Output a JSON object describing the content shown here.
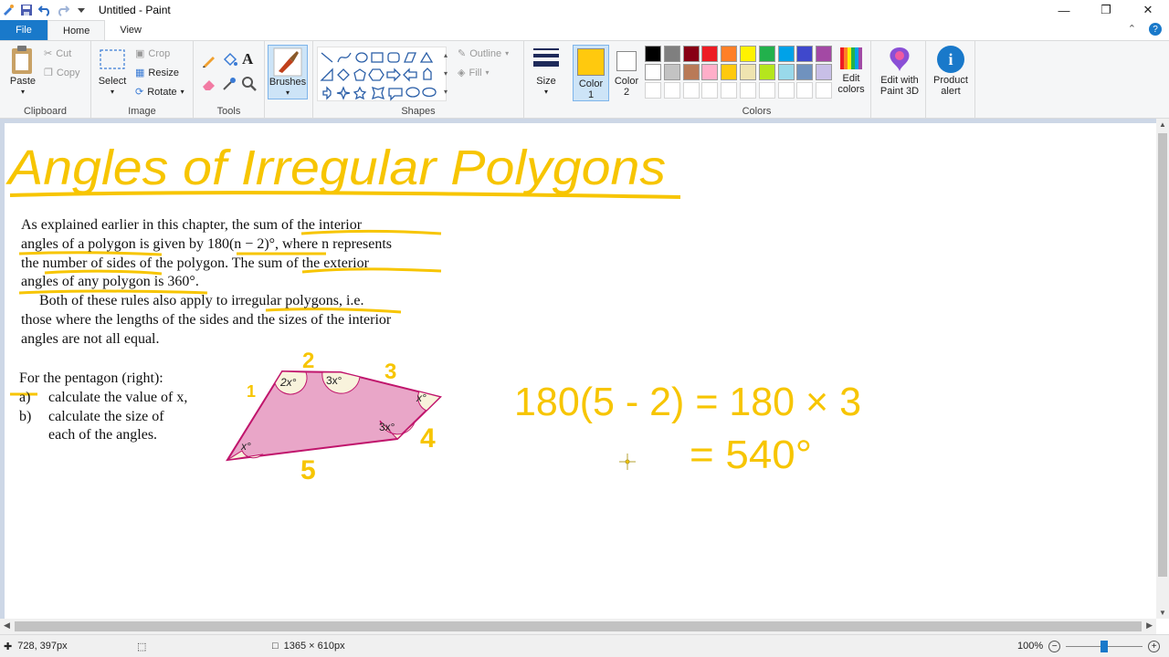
{
  "window": {
    "title": "Untitled - Paint"
  },
  "tabs": {
    "file": "File",
    "home": "Home",
    "view": "View"
  },
  "ribbon": {
    "clipboard": {
      "label": "Clipboard",
      "paste": "Paste",
      "cut": "Cut",
      "copy": "Copy"
    },
    "image": {
      "label": "Image",
      "select": "Select",
      "crop": "Crop",
      "resize": "Resize",
      "rotate": "Rotate"
    },
    "tools": {
      "label": "Tools"
    },
    "brushes": "Brushes",
    "shapes": {
      "label": "Shapes",
      "outline": "Outline",
      "fill": "Fill"
    },
    "size": "Size",
    "color1": "Color 1",
    "color2": "Color 2",
    "colors": {
      "label": "Colors",
      "edit": "Edit colors",
      "palette_row1": [
        "#000000",
        "#7f7f7f",
        "#880015",
        "#ed1c24",
        "#ff7f27",
        "#fff200",
        "#22b14c",
        "#00a2e8",
        "#3f48cc",
        "#a349a4"
      ],
      "palette_row2": [
        "#ffffff",
        "#c3c3c3",
        "#b97a57",
        "#ffaec9",
        "#ffc90e",
        "#efe4b0",
        "#b5e61d",
        "#99d9ea",
        "#7092be",
        "#c8bfe7"
      ],
      "color1_value": "#ffc90e",
      "color2_value": "#ffffff"
    },
    "edit_paint3d": "Edit with Paint 3D",
    "product_alert": "Product alert"
  },
  "canvas": {
    "heading": "Angles of Irregular Polygons",
    "paragraph1": [
      "As explained earlier in this chapter, the sum of the interior",
      "angles of a polygon is given by 180(n − 2)°, where n represents",
      "the number of sides of the polygon. The sum of the exterior",
      "angles of any polygon is 360°."
    ],
    "paragraph2": [
      "Both of these rules also apply to irregular polygons, i.e.",
      "those where the lengths of the sides and the sizes of the interior",
      "angles are not all equal."
    ],
    "question_intro": "For the pentagon (right):",
    "question_a_label": "a)",
    "question_a": "calculate the value of x,",
    "question_b_label": "b)",
    "question_b1": "calculate the size of",
    "question_b2": "each of the angles.",
    "angle_labels": [
      "2x°",
      "3x°",
      "x°",
      "3x°",
      "x°"
    ],
    "side_numbers": [
      "1",
      "2",
      "3",
      "4",
      "5"
    ],
    "work_line1": "180(5 - 2) = 180 × 3",
    "work_line2": "= 540°"
  },
  "status": {
    "cursor_pos": "728, 397px",
    "image_size": "1365 × 610px",
    "zoom": "100%"
  }
}
